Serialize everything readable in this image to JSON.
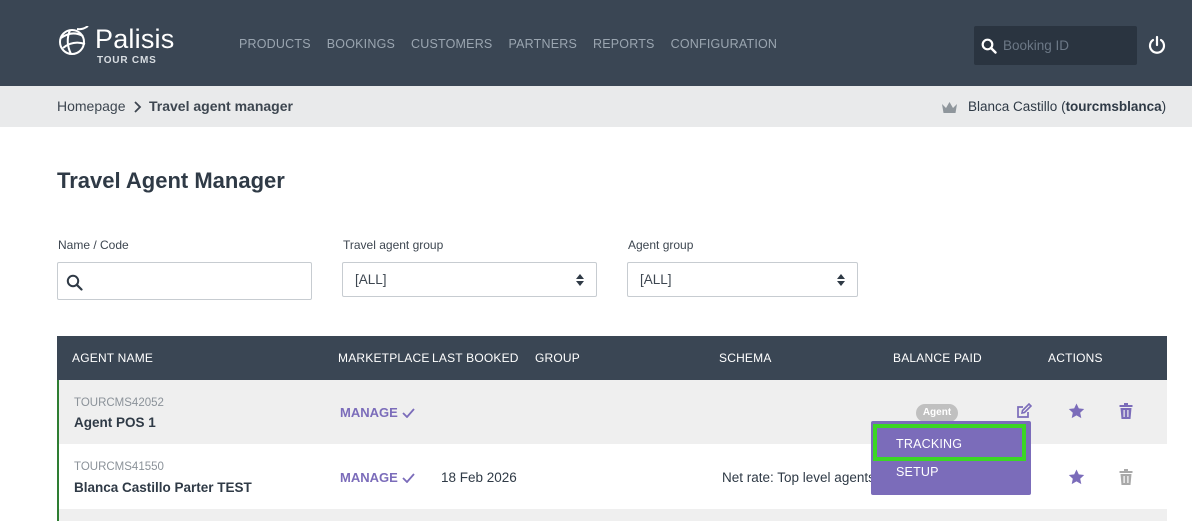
{
  "app": {
    "brand": "Palisis",
    "brand_sub": "TOUR CMS"
  },
  "nav": {
    "items": [
      "PRODUCTS",
      "BOOKINGS",
      "CUSTOMERS",
      "PARTNERS",
      "REPORTS",
      "CONFIGURATION"
    ]
  },
  "search": {
    "placeholder": "Booking ID",
    "icon": "search-icon"
  },
  "header_icons": {
    "power": "power-icon"
  },
  "breadcrumb": {
    "home": "Homepage",
    "current": "Travel agent manager"
  },
  "user": {
    "name": "Blanca Castillo",
    "open_paren": "(",
    "username": "tourcmsblanca",
    "close_paren": ")",
    "icon": "crown-icon"
  },
  "page": {
    "title": "Travel Agent Manager"
  },
  "filters": {
    "name_label": "Name / Code",
    "name_value": "",
    "ta_group_label": "Travel agent group",
    "ta_group_value": "[ALL]",
    "agent_group_label": "Agent group",
    "agent_group_value": "[ALL]"
  },
  "table": {
    "headers": {
      "agent_name": "AGENT NAME",
      "marketplace": "MARKETPLACE",
      "last_booked": "LAST BOOKED",
      "group": "GROUP",
      "schema": "SCHEMA",
      "balance_paid": "BALANCE PAID",
      "actions": "ACTIONS"
    },
    "rows": [
      {
        "code": "TOURCMS42052",
        "name": "Agent POS 1",
        "marketplace": "MANAGE",
        "last_booked": "",
        "group": "",
        "schema": "",
        "badge": "Agent"
      },
      {
        "code": "TOURCMS41550",
        "name": "Blanca Castillo Parter TEST",
        "marketplace": "MANAGE",
        "last_booked": "18 Feb 2026",
        "group": "",
        "schema": "Net rate: Top level agents",
        "badge": ""
      }
    ]
  },
  "dropdown": {
    "items": [
      "TRACKING",
      "SETUP"
    ],
    "highlighted": "TRACKING"
  },
  "colors": {
    "header_bg": "#3a4654",
    "accent": "#7b6cba",
    "highlight": "#3bd624",
    "row_marker": "#2e7d32"
  }
}
